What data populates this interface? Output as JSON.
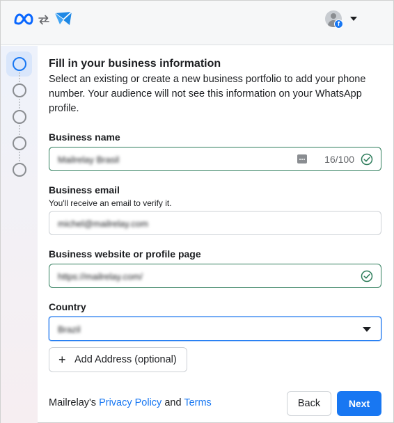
{
  "header": {
    "icons": [
      "meta-logo",
      "sync-icon",
      "app-logo",
      "avatar",
      "facebook-badge",
      "caret-down"
    ],
    "fb_badge": "f"
  },
  "steps": {
    "count": 5,
    "active_index": 0
  },
  "form": {
    "title": "Fill in your business information",
    "intro": "Select an existing or create a new business portfolio to add your phone number. Your audience will not see this information on your WhatsApp profile.",
    "business_name": {
      "label": "Business name",
      "value": "Mailrelay Brasil",
      "counter": "16/100",
      "valid": true
    },
    "business_email": {
      "label": "Business email",
      "hint": "You'll receive an email to verify it.",
      "value": "michel@mailrelay.com"
    },
    "website": {
      "label": "Business website or profile page",
      "value": "https://mailrelay.com/",
      "valid": true
    },
    "country": {
      "label": "Country",
      "value": "Brazil"
    },
    "add_address_label": "Add Address (optional)"
  },
  "footer": {
    "prefix": "Mailrelay's ",
    "privacy_link": "Privacy Policy",
    "and": " and ",
    "terms_link": "Terms",
    "back_label": "Back",
    "next_label": "Next"
  },
  "colors": {
    "accent": "#1877f2",
    "valid": "#2e7d5b",
    "muted": "#65676b"
  }
}
